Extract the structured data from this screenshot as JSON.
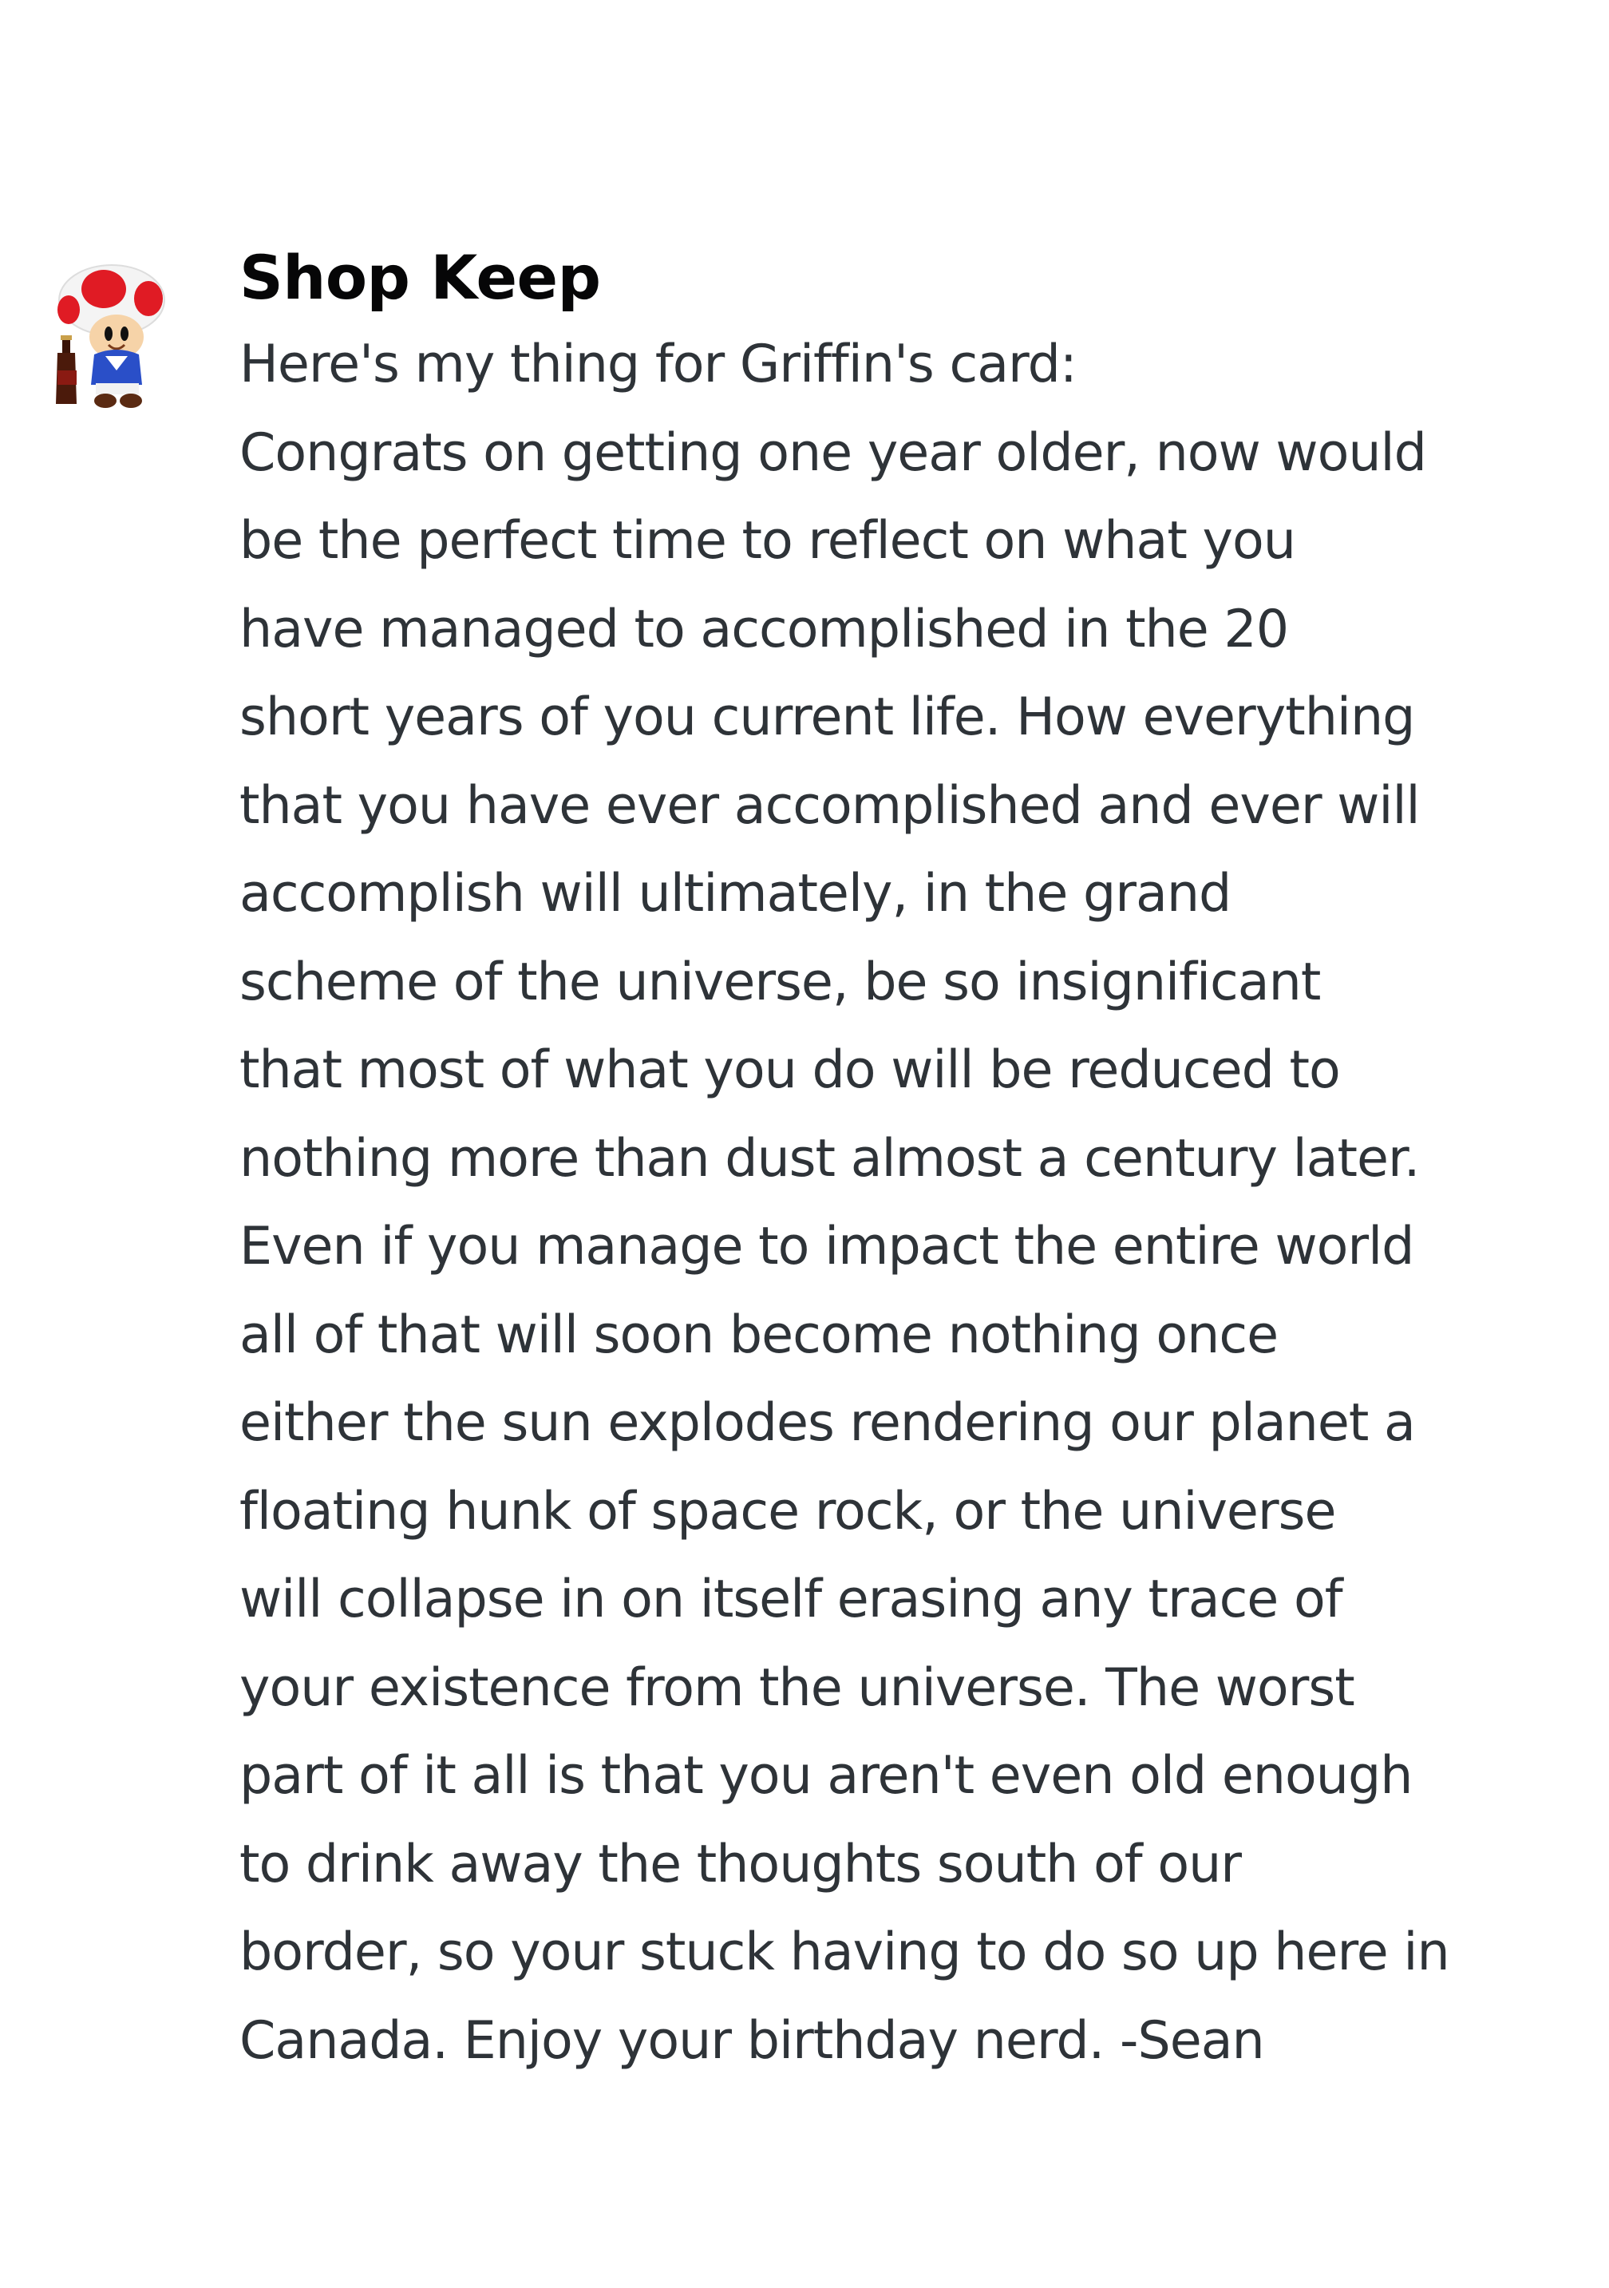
{
  "message": {
    "author": "Shop Keep",
    "avatar_icon": "toad-with-bottle-avatar",
    "lines": [
      "Here's my thing for Griffin's card:",
      "Congrats on getting one year older, now would",
      "be the perfect time to reflect on what you",
      "have managed to accomplished in the 20",
      "short years of you current life. How everything",
      "that you have ever accomplished and ever will",
      "accomplish will ultimately, in the grand",
      "scheme of the universe, be so insignificant",
      "that most of what you do will be reduced to",
      "nothing more than dust almost a century later.",
      "Even if you manage to impact the entire world",
      "all of that will soon become nothing once",
      "either the sun explodes rendering our planet a",
      "floating hunk of space rock, or the universe",
      "will collapse in on itself erasing any trace of",
      "your existence from the universe. The worst",
      "part of it all is that you aren't even old enough",
      "to drink away the thoughts south of our",
      "border, so your stuck having to do so up here in",
      "Canada. Enjoy your birthday nerd. -Sean"
    ]
  },
  "colors": {
    "background": "#ffffff",
    "username": "#060607",
    "text": "#2e3338"
  }
}
